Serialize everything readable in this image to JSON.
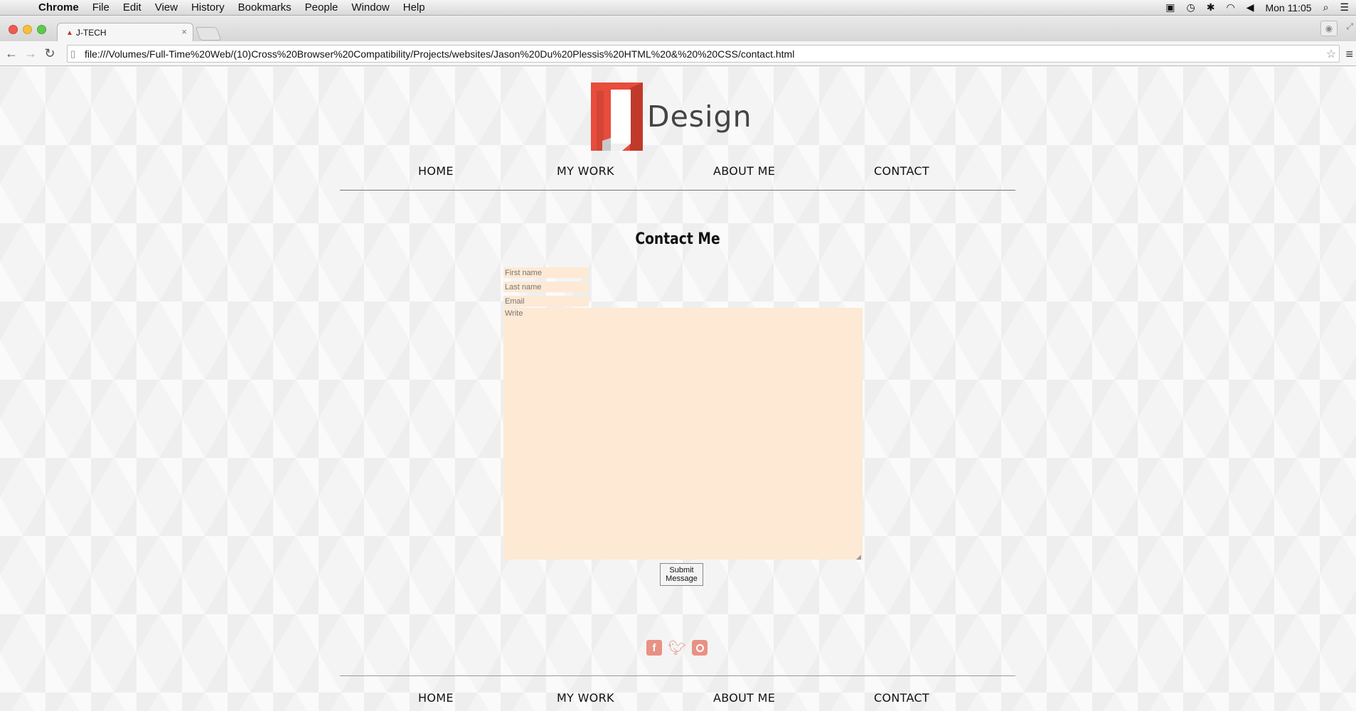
{
  "menubar": {
    "app": "Chrome",
    "items": [
      "File",
      "Edit",
      "View",
      "History",
      "Bookmarks",
      "People",
      "Window",
      "Help"
    ],
    "clock": "Mon 11:05"
  },
  "browser": {
    "tab_title": "J-TECH",
    "url": "file:///Volumes/Full-Time%20Web/(10)Cross%20Browser%20Compatibility/Projects/websites/Jason%20Du%20Plessis%20HTML%20&%20%20CSS/contact.html"
  },
  "page": {
    "logo_text": "Design",
    "nav": [
      "HOME",
      "MY WORK",
      "ABOUT ME",
      "CONTACT"
    ],
    "heading": "Contact Me",
    "form": {
      "first_name_placeholder": "First name",
      "last_name_placeholder": "Last name",
      "email_placeholder": "Email",
      "message_placeholder": "Write",
      "submit_label": "Submit\nMessage"
    },
    "colors": {
      "logo_red": "#e74c3c",
      "form_field_bg": "#fde9d4",
      "social_icon": "#e89185"
    }
  }
}
